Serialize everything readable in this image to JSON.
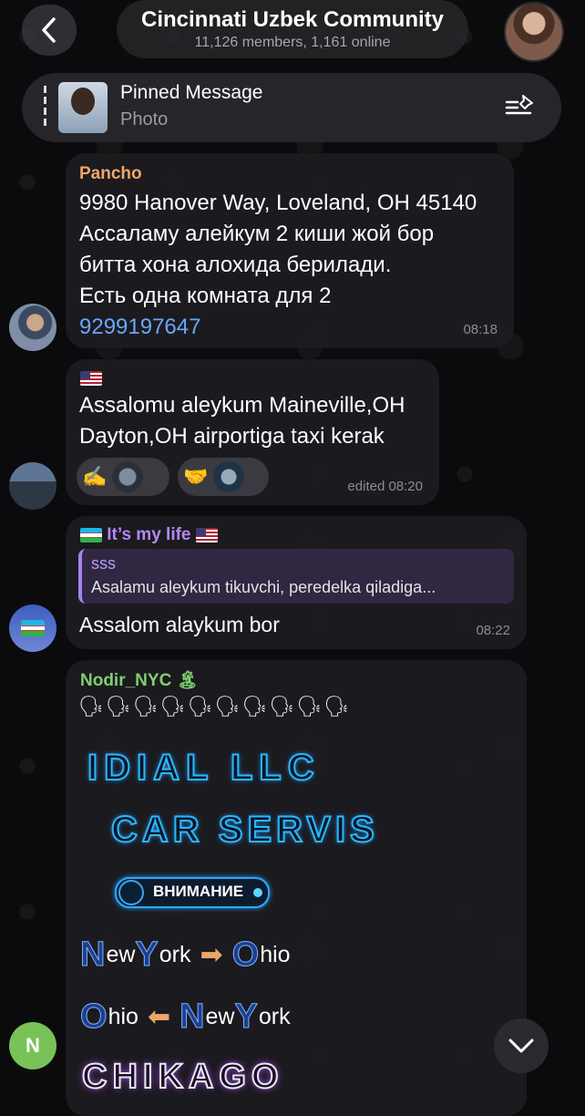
{
  "header": {
    "title": "Cincinnati Uzbek Community",
    "subtitle": "11,126 members, 1,161 online"
  },
  "pinned": {
    "title": "Pinned Message",
    "subtitle": "Photo"
  },
  "messages": [
    {
      "sender": "Pancho",
      "lines": [
        "9980 Hanover Way, Loveland, OH 45140",
        "Ассаламу алейкум 2 киши жой бор",
        "битта хона алохида берилади.",
        "Есть одна комната для 2"
      ],
      "phone": "9299197647",
      "time": "08:18"
    },
    {
      "lines": [
        "Assalomu aleykum Maineville,OH",
        "Dayton,OH airportiga taxi kerak"
      ],
      "reactions": [
        "✍️",
        "🤝"
      ],
      "time": "edited 08:20"
    },
    {
      "sender": "It’s my life",
      "reply_name": "sss",
      "reply_text": "Asalamu aleykum tikuvchi, peredelka qiladiga...",
      "text": "Assalom alaykum bor",
      "time": "08:22"
    },
    {
      "sender": "Nodir_NYC",
      "sender_emoji": "🏝",
      "speaking_row": "🗣🗣🗣🗣🗣🗣🗣🗣🗣🗣",
      "neon_line1": "IDIAL LLC",
      "neon_line2": "CAR SERVIS",
      "badge": "ВНИМАНИЕ",
      "route1": {
        "a_big": "N",
        "a_rest": "ew",
        "b_big": "Y",
        "b_rest": "ork",
        "arrow": "➡",
        "c_big": "O",
        "c_rest": "hio"
      },
      "route2": {
        "a_big": "O",
        "a_rest": "hio",
        "arrow": "⬅",
        "b_big": "N",
        "b_rest": "ew",
        "c_big": "Y",
        "c_rest": "ork"
      },
      "neon_line3": "CHIKAGO"
    }
  ],
  "avatar_n": "N"
}
